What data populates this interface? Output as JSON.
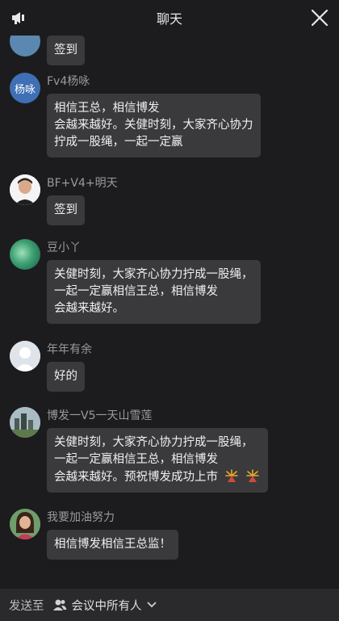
{
  "header": {
    "title": "聊天",
    "left_icon": "megaphone-icon",
    "right_icon": "close-icon"
  },
  "messages": [
    {
      "name": "",
      "lines": [
        "签到"
      ],
      "avatar": "partial-avatar"
    },
    {
      "name": "Fv4杨咏",
      "avatar_text": "杨咏",
      "lines": [
        "相信王总，相信博发",
        "会越来越好。关健时刻，大家齐心协力",
        "拧成一股绳，一起一定赢"
      ]
    },
    {
      "name": "BF+V4+明天",
      "lines": [
        "签到"
      ],
      "avatar": "portrait-photo"
    },
    {
      "name": "豆小丫",
      "lines": [
        "关健时刻，大家齐心协力拧成一股绳，",
        "一起一定赢相信王总，相信博发",
        "会越来越好。"
      ],
      "avatar": "green-abstract-photo"
    },
    {
      "name": "年年有余",
      "lines": [
        "好的"
      ],
      "avatar": "default-person-avatar"
    },
    {
      "name": "博发一V5一天山雪莲",
      "lines": [
        "关健时刻，大家齐心协力拧成一股绳，",
        "一起一定赢相信王总，相信博发",
        "会越来越好。预祝博发成功上市"
      ],
      "avatar": "city-photo",
      "emoji": "fireworks-icon"
    },
    {
      "name": "我要加油努力",
      "lines": [
        "相信博发相信王总监！"
      ],
      "avatar": "woman-photo"
    }
  ],
  "footer": {
    "label": "发送至",
    "target": "会议中所有人",
    "icon": "people-icon",
    "chevron": "chevron-down-icon"
  },
  "colors": {
    "background": "#1c1c1e",
    "bubble": "#3a3a3c",
    "footer": "#2a2a2c",
    "avatar_blue": "#3f6fb5"
  }
}
